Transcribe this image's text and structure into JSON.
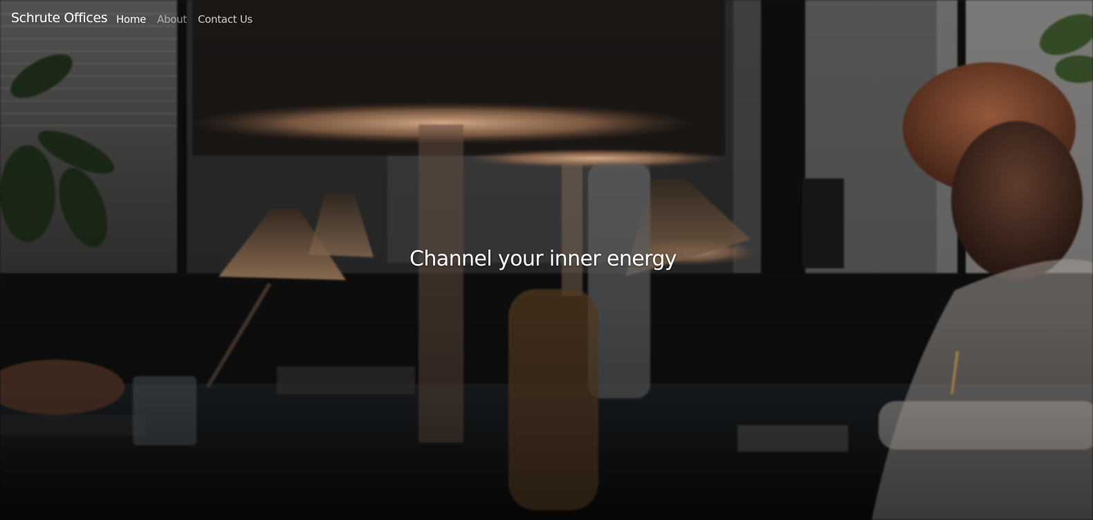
{
  "brand": {
    "name": "Schrute Offices"
  },
  "nav": {
    "items": [
      {
        "label": "Home",
        "state": "active"
      },
      {
        "label": "About",
        "state": "muted"
      },
      {
        "label": "Contact Us",
        "state": "default"
      }
    ]
  },
  "hero": {
    "headline": "Channel your inner energy",
    "background": "dim office workspace with desk lamps and a man writing at a desk"
  },
  "colors": {
    "text": "#ffffff",
    "lamp_glow": "#e7b38a",
    "background_dark": "#141312"
  }
}
